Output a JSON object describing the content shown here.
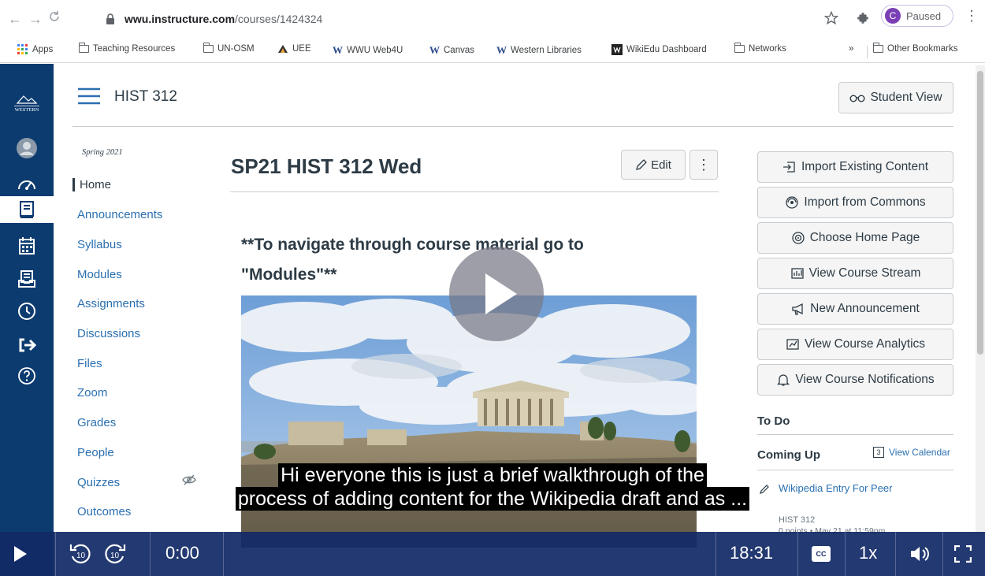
{
  "browser": {
    "url_host": "wwu.instructure.com",
    "url_path": "/courses/1424324",
    "profile_initial": "C",
    "profile_status": "Paused",
    "bookmarks": [
      {
        "label": "Apps",
        "icon": "apps-grid-icon"
      },
      {
        "label": "Teaching Resources",
        "icon": "folder-icon"
      },
      {
        "label": "UN-OSM",
        "icon": "folder-icon"
      },
      {
        "label": "UEE",
        "icon": "triangle-logo-icon"
      },
      {
        "label": "WWU Web4U",
        "icon": "w-logo-icon"
      },
      {
        "label": "Canvas",
        "icon": "w-logo-icon"
      },
      {
        "label": "Western Libraries",
        "icon": "w-logo-icon"
      },
      {
        "label": "WikiEdu Dashboard",
        "icon": "wikiedu-logo-icon"
      },
      {
        "label": "Networks",
        "icon": "folder-icon"
      }
    ],
    "overflow_label": "»",
    "other_bookmarks": "Other Bookmarks",
    "w_glyph": "W"
  },
  "course": {
    "crumb": "HIST 312",
    "student_view": "Student View",
    "term": "Spring 2021",
    "nav": [
      "Home",
      "Announcements",
      "Syllabus",
      "Modules",
      "Assignments",
      "Discussions",
      "Files",
      "Zoom",
      "Grades",
      "People",
      "Quizzes",
      "Outcomes"
    ],
    "active_nav": "Home"
  },
  "page": {
    "title": "SP21 HIST 312 Wed",
    "edit_label": "Edit",
    "more_label": "⋮",
    "instructions": "**To navigate through course material go to \"Modules\"**"
  },
  "sidebar": {
    "buttons": [
      {
        "label": "Import Existing Content",
        "icon": "import-icon"
      },
      {
        "label": "Import from Commons",
        "icon": "commons-icon"
      },
      {
        "label": "Choose Home Page",
        "icon": "target-icon"
      },
      {
        "label": "View Course Stream",
        "icon": "stream-icon"
      },
      {
        "label": "New Announcement",
        "icon": "megaphone-icon"
      },
      {
        "label": "View Course Analytics",
        "icon": "analytics-icon"
      },
      {
        "label": "View Course Notifications",
        "icon": "bell-icon"
      }
    ],
    "todo_heading": "To Do",
    "coming_up_heading": "Coming Up",
    "view_calendar": "View Calendar",
    "calendar_day": "3",
    "upcoming_item": "Wikipedia Entry For Peer",
    "upcoming_course": "HIST 312",
    "upcoming_meta": "0 points • May 21 at 11:59pm"
  },
  "video": {
    "caption_line1": "Hi everyone this is just a brief walkthrough of the",
    "caption_line2": "process of adding content for the Wikipedia draft and as ...",
    "current_time": "0:00",
    "duration": "18:31",
    "speed": "1x",
    "skip_seconds": "10",
    "cc_label": "CC",
    "progress": 0.0
  },
  "colors": {
    "canvas_nav": "#0c3b70",
    "link": "#2a6fb0",
    "text": "#2d3b45",
    "player_bar": "#122a66"
  }
}
